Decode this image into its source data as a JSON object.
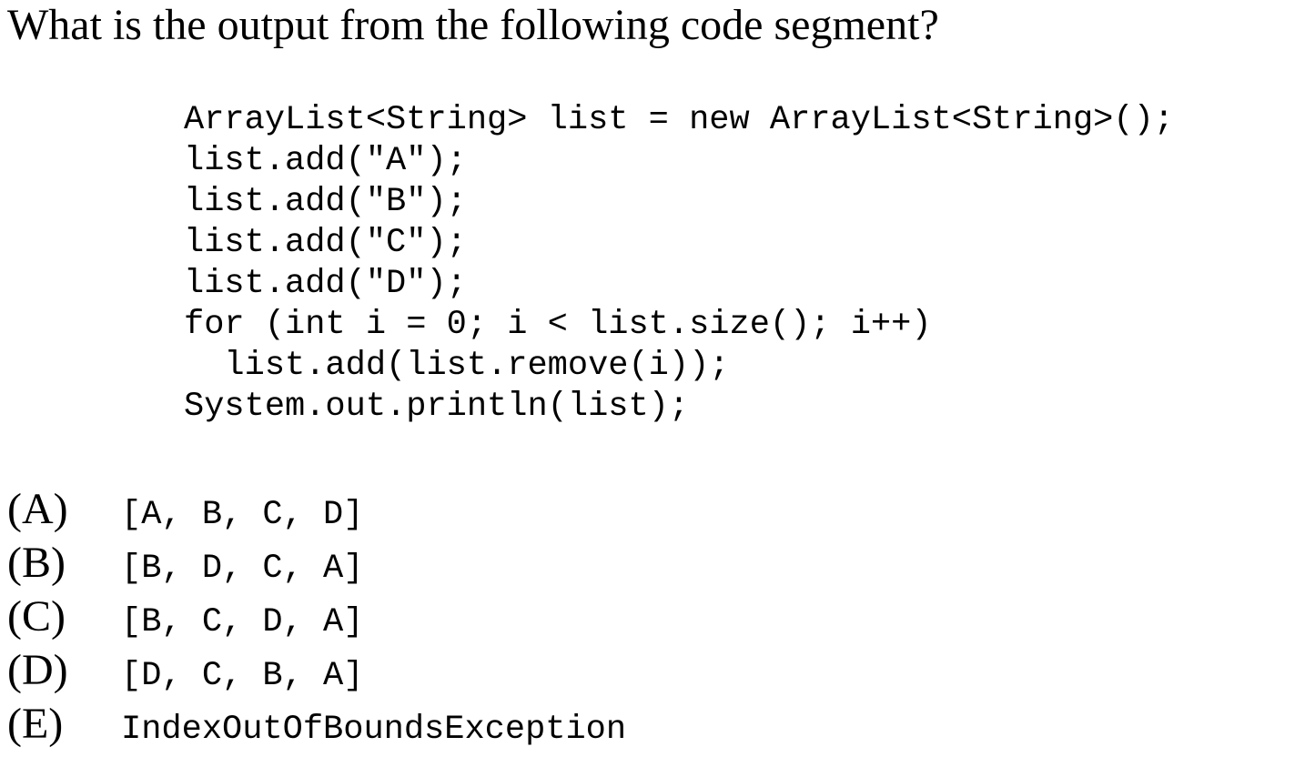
{
  "question": {
    "text": "What is the output from the following code segment?"
  },
  "code": {
    "lines": [
      "ArrayList<String> list = new ArrayList<String>();",
      "list.add(\"A\");",
      "list.add(\"B\");",
      "list.add(\"C\");",
      "list.add(\"D\");",
      "for (int i = 0; i < list.size(); i++)",
      "  list.add(list.remove(i));",
      "System.out.println(list);"
    ]
  },
  "choices": [
    {
      "letter": "(A)",
      "text": "[A, B, C, D]"
    },
    {
      "letter": "(B)",
      "text": "[B, D, C, A]"
    },
    {
      "letter": "(C)",
      "text": "[B, C, D, A]"
    },
    {
      "letter": "(D)",
      "text": "[D, C, B, A]"
    },
    {
      "letter": "(E)",
      "text": "IndexOutOfBoundsException"
    }
  ]
}
